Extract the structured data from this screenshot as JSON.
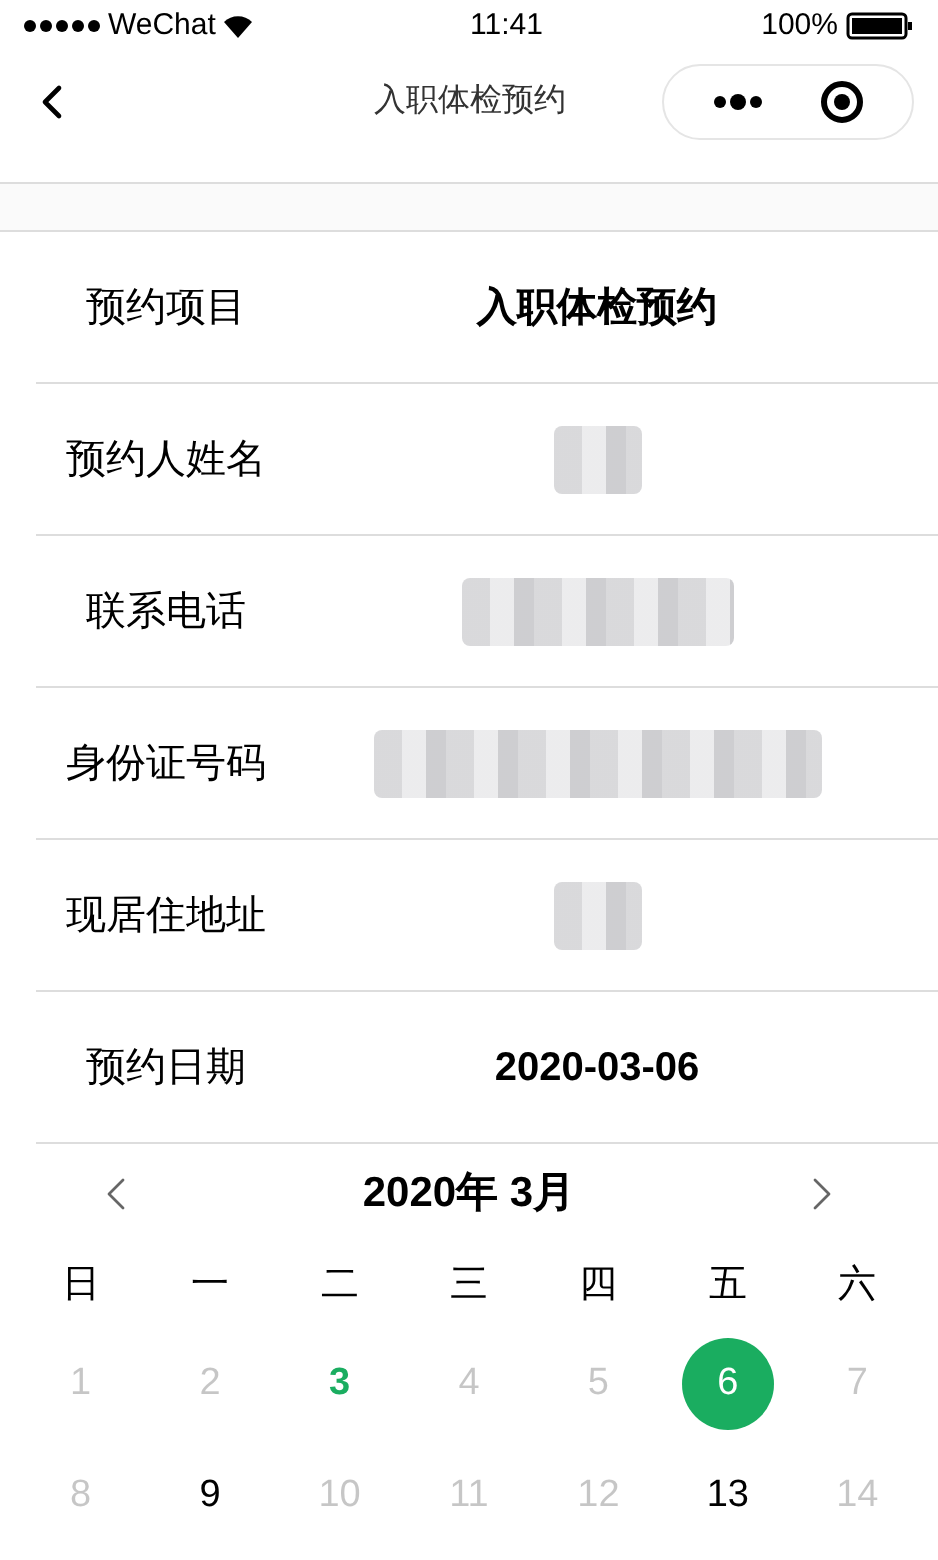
{
  "status_bar": {
    "carrier": "WeChat",
    "time": "11:41",
    "battery": "100%"
  },
  "nav": {
    "title": "入职体检预约"
  },
  "form": [
    {
      "label": "预约项目",
      "kind": "text",
      "value": "入职体检预约"
    },
    {
      "label": "预约人姓名",
      "kind": "redacted"
    },
    {
      "label": "联系电话",
      "kind": "redacted"
    },
    {
      "label": "身份证号码",
      "kind": "redacted"
    },
    {
      "label": "现居住地址",
      "kind": "redacted"
    },
    {
      "label": "预约日期",
      "kind": "text",
      "value": "2020-03-06"
    }
  ],
  "calendar": {
    "month": "2020年 3月",
    "weekdays": [
      "日",
      "一",
      "二",
      "三",
      "四",
      "五",
      "六"
    ],
    "days": [
      {
        "label": "1",
        "disabled": true,
        "today": false,
        "selected": false
      },
      {
        "label": "2",
        "disabled": true,
        "today": false,
        "selected": false
      },
      {
        "label": "3",
        "disabled": false,
        "today": true,
        "selected": false
      },
      {
        "label": "4",
        "disabled": true,
        "today": false,
        "selected": false
      },
      {
        "label": "5",
        "disabled": true,
        "today": false,
        "selected": false
      },
      {
        "label": "6",
        "disabled": false,
        "today": false,
        "selected": true
      },
      {
        "label": "7",
        "disabled": true,
        "today": false,
        "selected": false
      },
      {
        "label": "8",
        "disabled": true,
        "today": false,
        "selected": false
      },
      {
        "label": "9",
        "disabled": false,
        "today": false,
        "selected": false
      },
      {
        "label": "10",
        "disabled": true,
        "today": false,
        "selected": false
      },
      {
        "label": "11",
        "disabled": true,
        "today": false,
        "selected": false
      },
      {
        "label": "12",
        "disabled": true,
        "today": false,
        "selected": false
      },
      {
        "label": "13",
        "disabled": false,
        "today": false,
        "selected": false
      },
      {
        "label": "14",
        "disabled": true,
        "today": false,
        "selected": false
      }
    ]
  }
}
